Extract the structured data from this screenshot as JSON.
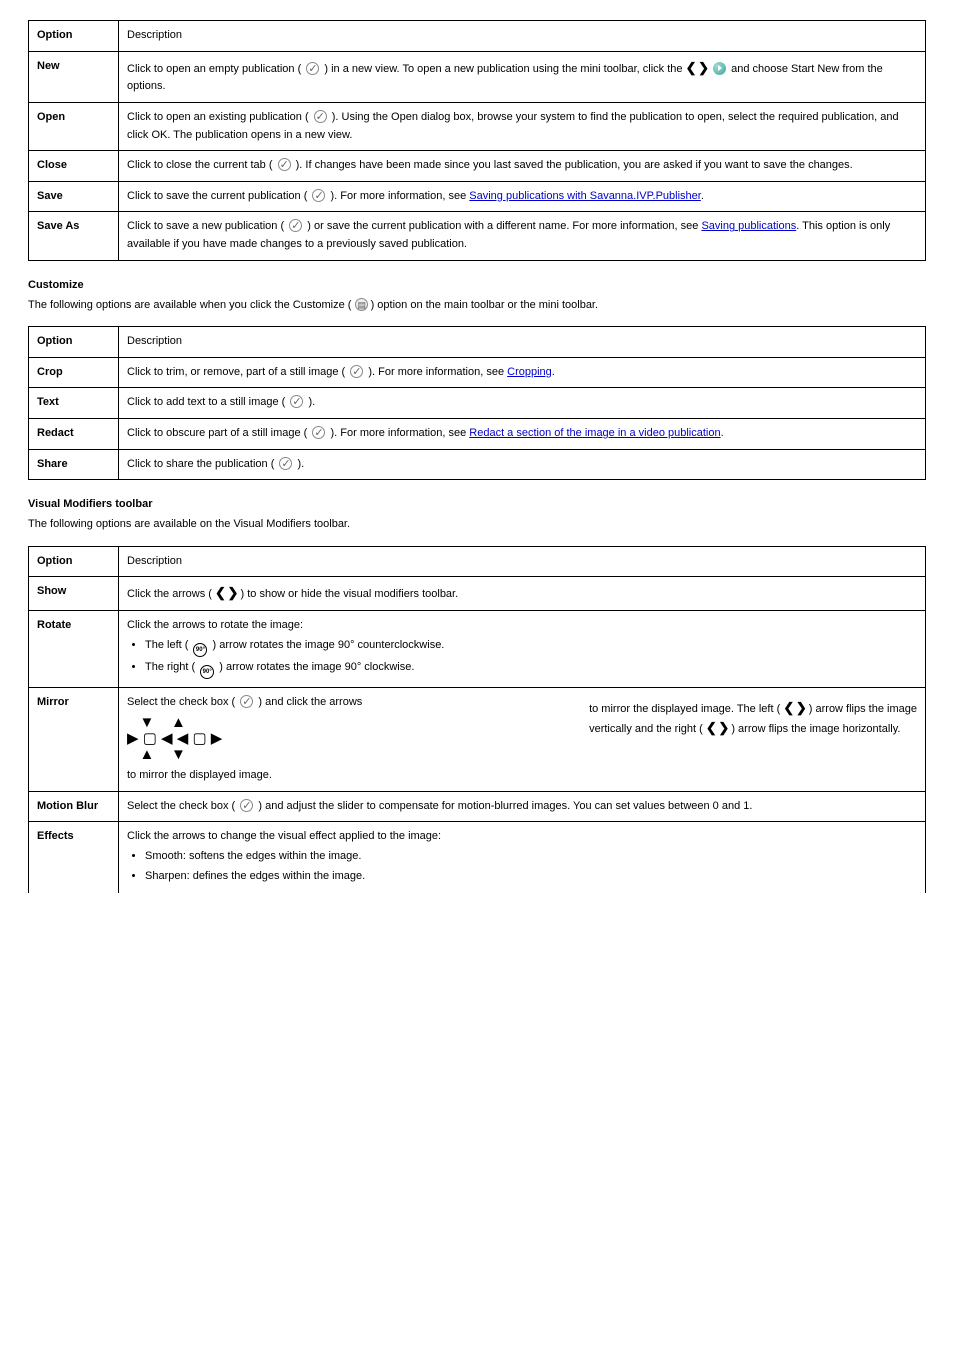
{
  "table1": {
    "header_col1": "Option",
    "header_col2": "Description",
    "rows": [
      {
        "opt": "New",
        "desc_pre": "Click to open an empty publication (",
        "desc_mid": ") in a new view. To open a new publication using the mini toolbar, click the",
        "desc_post": "and choose Start New from the options."
      },
      {
        "opt": "Open",
        "desc_pre": "Click to open an existing publication (",
        "desc_post": "). Using the Open dialog box, browse your system to find the publication to open, select the required publication, and click OK. The publication opens in a new view."
      },
      {
        "opt": "Close",
        "desc_pre": "Click to close the current tab (",
        "desc_post": "). If changes have been made since you last saved the publication, you are asked if you want to save the changes."
      },
      {
        "opt": "Save",
        "desc_pre": "Click to save the current publication (",
        "desc_post": "). For more information, see",
        "link": "Saving publications with Savanna.IVP.Publisher",
        "tail": "."
      },
      {
        "opt": "Save As",
        "desc_pre": "Click to save a new publication (",
        "desc_post": ") or save the current publication with a different name. For more information, see",
        "link": "Saving publications",
        "tail": ". This option is only available if you have made changes to a previously saved publication."
      }
    ]
  },
  "section_customize": {
    "head": "Customize",
    "intro_pre": "The following options are available when you click the Customize (",
    "intro_post": ") option on the main toolbar or the mini toolbar."
  },
  "table2": {
    "header_col1": "Option",
    "header_col2": "Description",
    "rows": [
      {
        "opt": "Crop",
        "desc_pre": "Click to trim, or remove, part of a still image (",
        "desc_post": "). For more information, see",
        "link": "Cropping",
        "tail": "."
      },
      {
        "opt": "Text",
        "desc_pre": "Click to add text to a still image (",
        "desc_post": ")."
      },
      {
        "opt": "Redact",
        "desc_pre": "Click to obscure part of a still image (",
        "desc_post": "). For more information, see",
        "link": "Redact a section of the image in a video publication",
        "tail": "."
      },
      {
        "opt": "Share",
        "desc_pre": "Click to share the publication (",
        "desc_post": ")."
      }
    ]
  },
  "section_visual": {
    "head": "Visual Modifiers toolbar",
    "intro": "The following options are available on the Visual Modifiers toolbar."
  },
  "table3": {
    "header_col1": "Option",
    "header_col2": "Description",
    "rows": [
      {
        "opt": "Show",
        "desc_pre": "Click the arrows (",
        "desc_post": ") to show or hide the visual modifiers toolbar."
      },
      {
        "opt": "Rotate",
        "desc": "Click the arrows to rotate the image:",
        "items": [
          {
            "pre": "The left (",
            "post": ") arrow rotates the image 90° counterclockwise."
          },
          {
            "pre": "The right (",
            "post": ") arrow rotates the image 90° clockwise."
          }
        ]
      },
      {
        "opt": "Mirror",
        "left_pre": "Select the check box (",
        "left_mid": ") and click the arrows",
        "left_post": "to mirror the displayed image.",
        "right_line1_pre": "to mirror the displayed image. The left (",
        "right_line1_post": ") arrow flips the image",
        "right_line2_pre": "vertically and the right (",
        "right_line2_post": ") arrow flips the image horizontally."
      },
      {
        "opt": "Motion Blur",
        "desc_pre": "Select the check box (",
        "desc_post": ") and adjust the slider to compensate for motion-blurred images. You can set values between 0 and 1."
      },
      {
        "opt": "Effects",
        "desc": "Click the arrows to change the visual effect applied to the image:",
        "items": [
          "Smooth: softens the edges within the image.",
          "Sharpen: defines the edges within the image."
        ]
      }
    ]
  }
}
